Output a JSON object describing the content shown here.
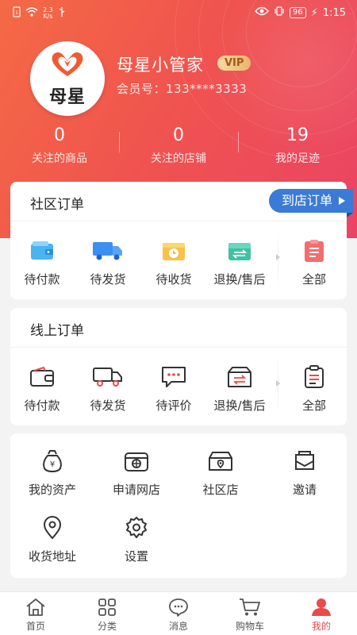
{
  "status_bar": {
    "speed_top": "2.3",
    "speed_unit": "K/s",
    "battery": "96",
    "time": "1:15"
  },
  "profile": {
    "avatar_text": "母星",
    "name": "母星小管家",
    "vip_badge": "VIP",
    "member_label": "会员号：133****3333"
  },
  "stats": [
    {
      "value": "0",
      "label": "关注的商品"
    },
    {
      "value": "0",
      "label": "关注的店铺"
    },
    {
      "value": "19",
      "label": "我的足迹"
    }
  ],
  "community_orders": {
    "title": "社区订单",
    "store_button": "到店订单",
    "items": [
      {
        "label": "待付款",
        "icon": "wallet-icon"
      },
      {
        "label": "待发货",
        "icon": "truck-icon"
      },
      {
        "label": "待收货",
        "icon": "package-clock-icon"
      },
      {
        "label": "退换/售后",
        "icon": "exchange-box-icon"
      },
      {
        "label": "全部",
        "icon": "clipboard-icon"
      }
    ]
  },
  "online_orders": {
    "title": "线上订单",
    "items": [
      {
        "label": "待付款",
        "icon": "wallet-icon"
      },
      {
        "label": "待发货",
        "icon": "truck-icon"
      },
      {
        "label": "待评价",
        "icon": "comment-icon"
      },
      {
        "label": "退换/售后",
        "icon": "exchange-box-icon"
      },
      {
        "label": "全部",
        "icon": "clipboard-icon"
      }
    ]
  },
  "tools": [
    {
      "label": "我的资产",
      "icon": "money-bag-icon"
    },
    {
      "label": "申请网店",
      "icon": "shop-icon"
    },
    {
      "label": "社区店",
      "icon": "community-store-icon"
    },
    {
      "label": "邀请",
      "icon": "invite-icon"
    },
    {
      "label": "收货地址",
      "icon": "location-icon"
    },
    {
      "label": "设置",
      "icon": "gear-icon"
    }
  ],
  "tabs": [
    {
      "label": "首页",
      "icon": "home-icon"
    },
    {
      "label": "分类",
      "icon": "category-icon"
    },
    {
      "label": "消息",
      "icon": "message-icon"
    },
    {
      "label": "购物车",
      "icon": "cart-icon"
    },
    {
      "label": "我的",
      "icon": "user-icon",
      "active": true
    }
  ],
  "colors": {
    "header_start": "#f46a45",
    "header_end": "#ea4464",
    "accent_blue": "#3b7bd6",
    "active_red": "#e94a4a"
  }
}
